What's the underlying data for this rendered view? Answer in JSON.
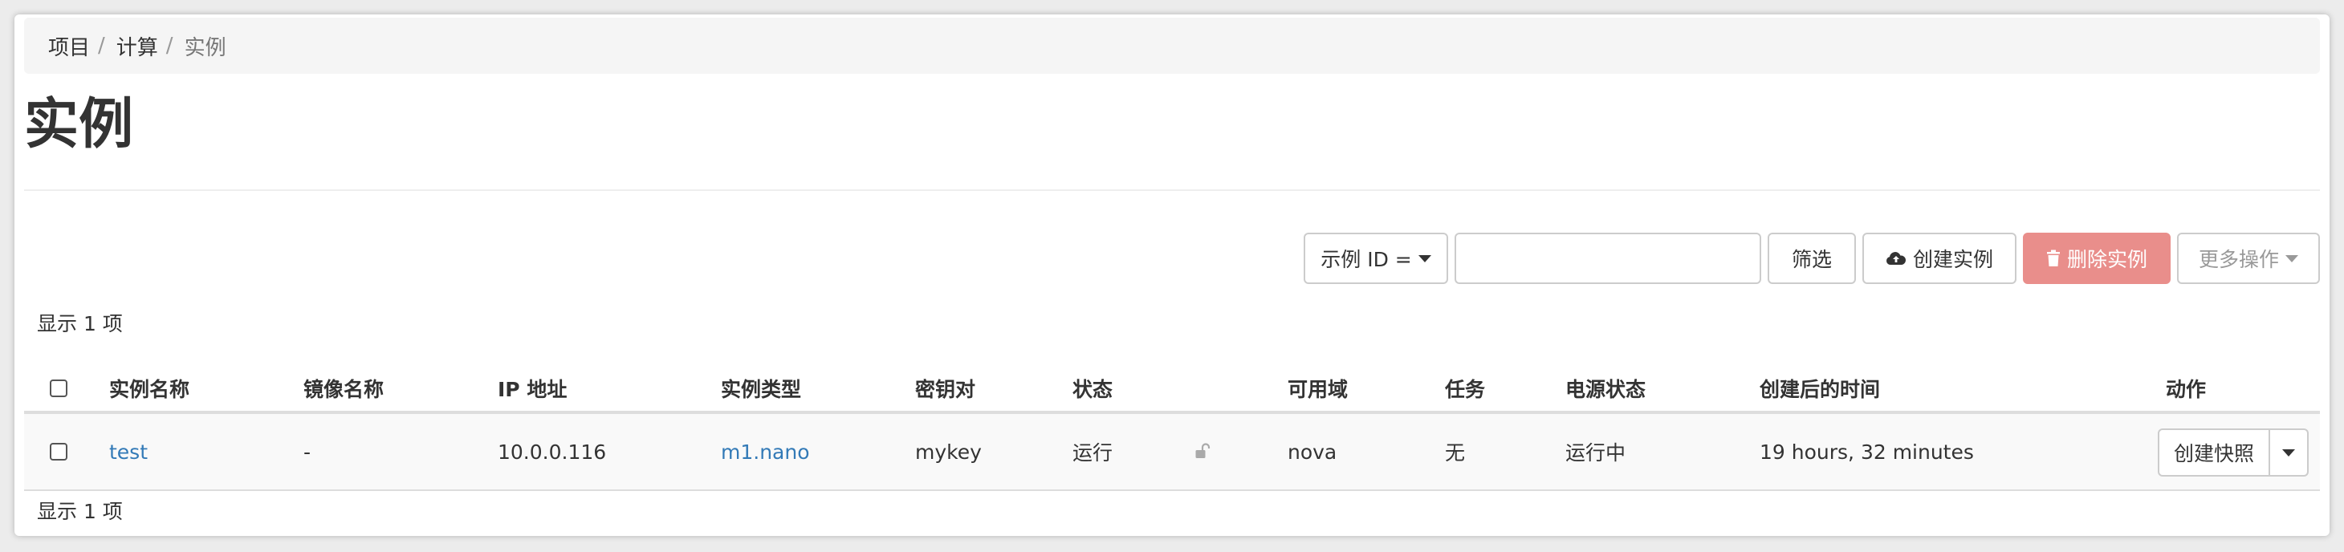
{
  "breadcrumb": {
    "items": [
      "项目",
      "计算",
      "实例"
    ],
    "separator": "/"
  },
  "page": {
    "title": "实例"
  },
  "toolbar": {
    "filter_field": "示例 ID =",
    "filter_input": {
      "value": "",
      "placeholder": ""
    },
    "filter_label": "筛选",
    "launch_label": "创建实例",
    "delete_label": "删除实例",
    "more_label": "更多操作",
    "launch_icon": "cloud-upload-icon",
    "delete_icon": "trash-icon"
  },
  "count_top": "显示 1 项",
  "count_bottom": "显示 1 项",
  "table": {
    "columns": [
      "实例名称",
      "镜像名称",
      "IP 地址",
      "实例类型",
      "密钥对",
      "状态",
      "",
      "可用域",
      "任务",
      "电源状态",
      "创建后的时间",
      "动作"
    ],
    "rows": [
      {
        "name": "test",
        "image": "-",
        "ip": "10.0.0.116",
        "flavor": "m1.nano",
        "keypair": "mykey",
        "status": "运行",
        "lock_icon": "unlock-icon",
        "az": "nova",
        "task": "无",
        "power": "运行中",
        "age": "19 hours, 32 minutes",
        "action_label": "创建快照"
      }
    ]
  },
  "colors": {
    "link": "#337ab7",
    "danger_disabled": "#e98e8b",
    "breadcrumb_bg": "#f5f5f5"
  }
}
